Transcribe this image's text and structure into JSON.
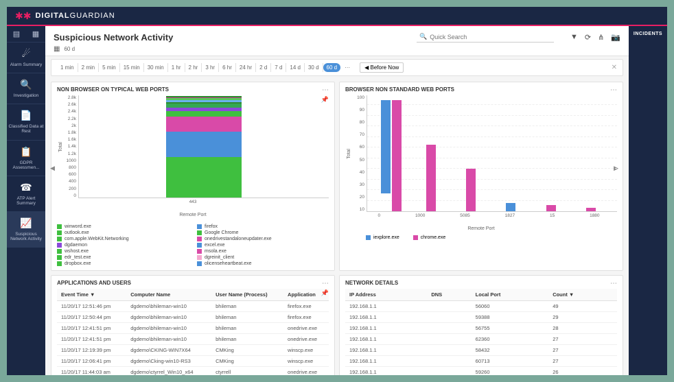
{
  "brand": {
    "name1": "DIGITAL",
    "name2": "GUARDIAN"
  },
  "sidebar": {
    "items": [
      {
        "label": "Alarm Summary",
        "glyph": "☄"
      },
      {
        "label": "Investigation",
        "glyph": "🔍"
      },
      {
        "label": "Classified Data at Rest",
        "glyph": "📄"
      },
      {
        "label": "GDPR Assessmen...",
        "glyph": "📋"
      },
      {
        "label": "ATP Alert Summary",
        "glyph": "☎"
      },
      {
        "label": "Suspicious Network Activity",
        "glyph": "📈"
      }
    ],
    "active_index": 5
  },
  "header": {
    "title": "Suspicious Network Activity",
    "time_badge": "60 d",
    "search_placeholder": "Quick Search"
  },
  "timebar": {
    "segments": [
      "1 min",
      "2 min",
      "5 min",
      "15 min",
      "30 min",
      "1 hr",
      "2 hr",
      "3 hr",
      "6 hr",
      "24 hr",
      "2 d",
      "7 d",
      "14 d",
      "30 d",
      "60 d"
    ],
    "active": "60 d",
    "before_now": "◀ Before Now"
  },
  "card1": {
    "title": "NON BROWSER ON TYPICAL WEB PORTS",
    "ylabel": "Total",
    "xlabel": "Remote Port",
    "xcat": "443",
    "yticks": [
      "2.8k",
      "2.6k",
      "2.4k",
      "2.2k",
      "2k",
      "1.8k",
      "1.6k",
      "1.4k",
      "1.2k",
      "1000",
      "800",
      "600",
      "400",
      "200",
      "0"
    ],
    "legend": [
      {
        "label": "winword.exe",
        "color": "#3fbf3f"
      },
      {
        "label": "firefox",
        "color": "#4a90d9"
      },
      {
        "label": "outlook.exe",
        "color": "#3fbf3f"
      },
      {
        "label": "Google Chrome",
        "color": "#3fbf3f"
      },
      {
        "label": "com.apple.WebKit.Networking",
        "color": "#3fbf3f"
      },
      {
        "label": "onedrivestandaloneupdater.exe",
        "color": "#d94aa8"
      },
      {
        "label": "dgdaemon",
        "color": "#8a4ad9"
      },
      {
        "label": "excel.exe",
        "color": "#4a90d9"
      },
      {
        "label": "wshost.exe",
        "color": "#3fbf3f"
      },
      {
        "label": "msola.exe",
        "color": "#d94aa8"
      },
      {
        "label": "edr_test.exe",
        "color": "#3fbf3f"
      },
      {
        "label": "dgreinit_client",
        "color": "#f5a8d0"
      },
      {
        "label": "dropbox.exe",
        "color": "#3fbf3f"
      },
      {
        "label": "olicenseheartbeat.exe",
        "color": "#4a90d9"
      }
    ]
  },
  "card2": {
    "title": "BROWSER NON STANDARD WEB PORTS",
    "ylabel": "Total",
    "xlabel": "Remote Port",
    "yticks": [
      "100",
      "90",
      "80",
      "70",
      "60",
      "50",
      "40",
      "30",
      "20",
      "10"
    ],
    "legend": [
      {
        "label": "iexplore.exe",
        "color": "#4a90d9"
      },
      {
        "label": "chrome.exe",
        "color": "#d94aa8"
      }
    ]
  },
  "card3": {
    "title": "APPLICATIONS AND USERS",
    "headers": [
      "Event Time ▼",
      "Computer Name",
      "User Name (Process)",
      "Application"
    ],
    "rows": [
      [
        "11/20/17 12:51:46 pm",
        "dgdemo\\bhileman-win10",
        "bhileman",
        "firefox.exe"
      ],
      [
        "11/20/17 12:50:44 pm",
        "dgdemo\\bhileman-win10",
        "bhileman",
        "firefox.exe"
      ],
      [
        "11/20/17 12:41:51 pm",
        "dgdemo\\bhileman-win10",
        "bhileman",
        "onedrive.exe"
      ],
      [
        "11/20/17 12:41:51 pm",
        "dgdemo\\bhileman-win10",
        "bhileman",
        "onedrive.exe"
      ],
      [
        "11/20/17 12:19:39 pm",
        "dgdemo\\CKING-WIN7X64",
        "CMKing",
        "winscp.exe"
      ],
      [
        "11/20/17 12:06:41 pm",
        "dgdemo\\Cking-win10-RS3",
        "CMKing",
        "winscp.exe"
      ],
      [
        "11/20/17 11:44:03 am",
        "dgdemo\\ctyrrel_Win10_x64",
        "ctyrrell",
        "onedrive.exe"
      ]
    ]
  },
  "card4": {
    "title": "NETWORK DETAILS",
    "headers": [
      "IP Address",
      "DNS",
      "Local Port",
      "Count ▼"
    ],
    "rows": [
      [
        "192.168.1.1",
        "",
        "56060",
        "49"
      ],
      [
        "192.168.1.1",
        "",
        "59388",
        "29"
      ],
      [
        "192.168.1.1",
        "",
        "56755",
        "28"
      ],
      [
        "192.168.1.1",
        "",
        "62360",
        "27"
      ],
      [
        "192.168.1.1",
        "",
        "58432",
        "27"
      ],
      [
        "192.168.1.1",
        "",
        "60713",
        "27"
      ],
      [
        "192.168.1.1",
        "",
        "59260",
        "26"
      ]
    ]
  },
  "rightbar": {
    "incidents": "INCIDENTS"
  },
  "chart_data": [
    {
      "type": "bar",
      "stacked": true,
      "title": "NON BROWSER ON TYPICAL WEB PORTS",
      "xlabel": "Remote Port",
      "ylabel": "Total",
      "ylim": [
        0,
        2800
      ],
      "categories": [
        "443"
      ],
      "series": [
        {
          "name": "winword.exe",
          "values": [
            1100
          ],
          "color": "#3fbf3f"
        },
        {
          "name": "firefox",
          "values": [
            700
          ],
          "color": "#4a90d9"
        },
        {
          "name": "onedrivestandaloneupdater.exe",
          "values": [
            400
          ],
          "color": "#d94aa8"
        },
        {
          "name": "outlook.exe",
          "values": [
            150
          ],
          "color": "#3fbf3f"
        },
        {
          "name": "dgdaemon",
          "values": [
            100
          ],
          "color": "#8a4ad9"
        },
        {
          "name": "wshost.exe",
          "values": [
            100
          ],
          "color": "#34a853"
        },
        {
          "name": "edr_test.exe",
          "values": [
            50
          ],
          "color": "#2e8b2e"
        },
        {
          "name": "excel.exe",
          "values": [
            50
          ],
          "color": "#6ab0ef"
        },
        {
          "name": "Google Chrome",
          "values": [
            50
          ],
          "color": "#56c956"
        },
        {
          "name": "msola.exe",
          "values": [
            30
          ],
          "color": "#c23b91"
        },
        {
          "name": "dropbox.exe",
          "values": [
            30
          ],
          "color": "#2e8b2e"
        }
      ]
    },
    {
      "type": "bar",
      "grouped": true,
      "title": "BROWSER NON STANDARD WEB PORTS",
      "xlabel": "Remote Port",
      "ylabel": "Total",
      "ylim": [
        0,
        110
      ],
      "categories": [
        "0",
        "1000",
        "5085",
        "1827",
        "15",
        "1880"
      ],
      "series": [
        {
          "name": "iexplore.exe",
          "values": [
            88,
            0,
            0,
            8,
            0,
            0
          ],
          "color": "#4a90d9"
        },
        {
          "name": "chrome.exe",
          "values": [
            105,
            63,
            40,
            0,
            6,
            3
          ],
          "color": "#d94aa8"
        }
      ]
    }
  ]
}
